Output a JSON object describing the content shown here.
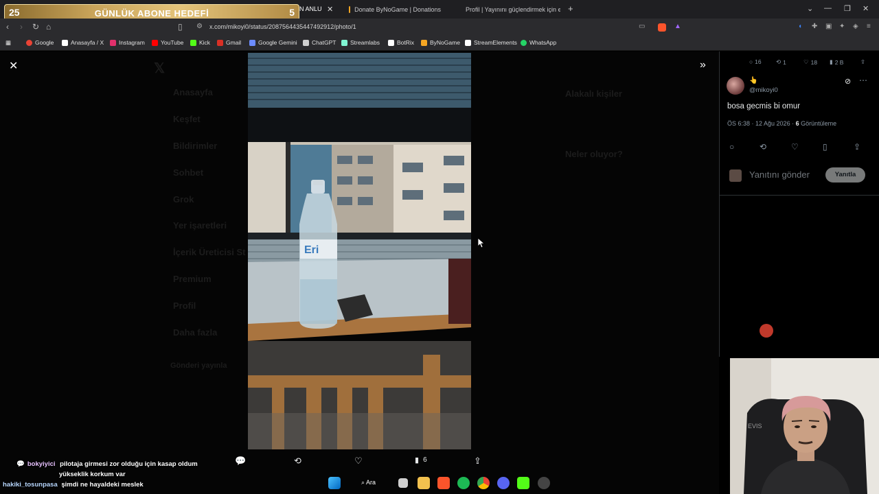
{
  "goal": {
    "current": "25",
    "title": "GÜNLÜK ABONE HEDEFİ",
    "target": "5",
    "tab_partial": "N ANLU"
  },
  "tabs": [
    {
      "label": "Donate ByNoGame | Donations"
    },
    {
      "label": "Profil | Yayınını güçlendirmek için en"
    }
  ],
  "url": "x.com/mikoyi0/status/2087564435447492912/photo/1",
  "bookmarks": [
    {
      "label": "Google",
      "color": "#ea4335"
    },
    {
      "label": "Anasayfa / X",
      "color": "#ffffff"
    },
    {
      "label": "Instagram",
      "color": "#e1306c"
    },
    {
      "label": "YouTube",
      "color": "#ff0000"
    },
    {
      "label": "Kick",
      "color": "#53fc18"
    },
    {
      "label": "Gmail",
      "color": "#d93025"
    },
    {
      "label": "Google Gemini",
      "color": "#6c8cff"
    },
    {
      "label": "ChatGPT",
      "color": "#cfcfcf"
    },
    {
      "label": "Streamlabs",
      "color": "#80f5d2"
    },
    {
      "label": "BotRix",
      "color": "#ffffff"
    },
    {
      "label": "ByNoGame",
      "color": "#f5a623"
    },
    {
      "label": "StreamElements",
      "color": "#ffffff"
    },
    {
      "label": "WhatsApp",
      "color": "#25d366"
    }
  ],
  "ghost_nav": [
    "Anasayfa",
    "Keşfet",
    "Bildirimler",
    "Sohbet",
    "Grok",
    "Yer işaretleri",
    "İçerik Üreticisi St",
    "Premium",
    "Profil",
    "Daha fazla"
  ],
  "ghost_post_button": "Gönderi yayınla",
  "ghost_right": {
    "who_to_follow": "Alakalı kişiler",
    "whats_happening": "Neler oluyor?"
  },
  "tweet": {
    "stats": {
      "replies": "16",
      "reposts": "1",
      "likes": "18",
      "views": "2 B"
    },
    "handle": "@mikoyi0",
    "name_emoji": "👆",
    "text": "bosa gecmis bi omur",
    "time": "ÖS 6:38 · 12 Ağu 2026 · ",
    "views_count": "6",
    "views_label": "Görüntüleme",
    "reply_placeholder": "Yanıtını gönder",
    "reply_button": "Yanıtla"
  },
  "media_views": "6",
  "chat": [
    {
      "user": "bokyiyici",
      "lines": [
        "pilotaja girmesi zor olduğu için kasap oldum",
        "yükseklik korkum var"
      ]
    },
    {
      "user": "hakiki_tosunpasa",
      "lines": [
        "şimdi ne hayaldeki meslek"
      ]
    }
  ],
  "taskbar": {
    "search": "Ara"
  }
}
